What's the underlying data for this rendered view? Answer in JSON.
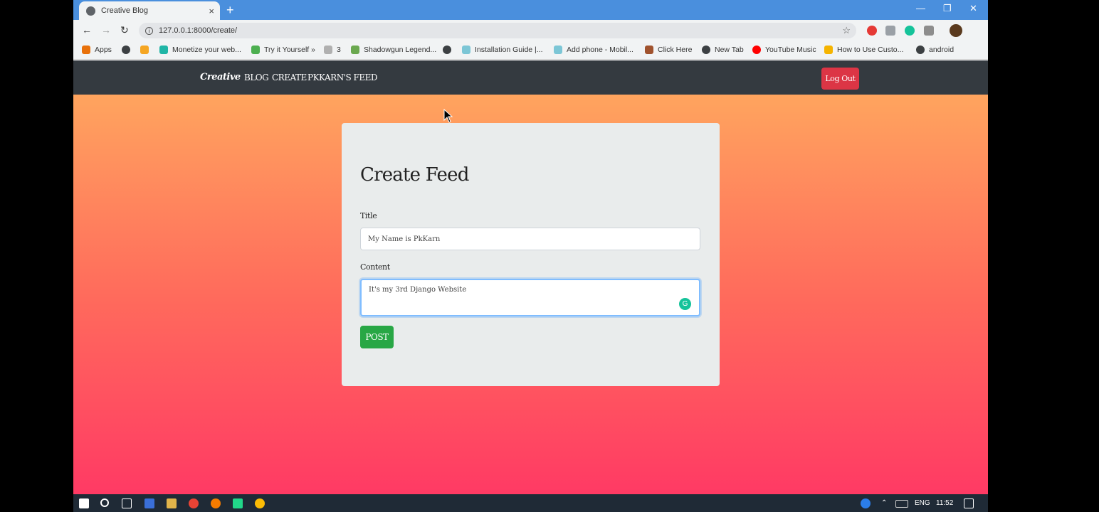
{
  "browser": {
    "tab_title": "Creative Blog",
    "tab_close": "×",
    "new_tab": "+",
    "url": "127.0.0.1:8000/create/",
    "window_controls": [
      "—",
      "❐",
      "✕"
    ]
  },
  "bookmarks": [
    {
      "label": "Apps",
      "icon": "apps-grid-icon"
    },
    {
      "label": "",
      "icon": "globe-icon"
    },
    {
      "label": "",
      "icon": "cp-icon"
    },
    {
      "label": "Monetize your web...",
      "icon": "monetize-icon"
    },
    {
      "label": "Try it Yourself »",
      "icon": "w3-icon"
    },
    {
      "label": "3",
      "icon": "k-icon"
    },
    {
      "label": "Shadowgun Legend...",
      "icon": "android-icon"
    },
    {
      "label": "",
      "icon": "globe-icon"
    },
    {
      "label": "Installation Guide |...",
      "icon": "link-icon"
    },
    {
      "label": "Add phone - Mobil...",
      "icon": "link-icon"
    },
    {
      "label": "Click Here",
      "icon": "hat-icon"
    },
    {
      "label": "New Tab",
      "icon": "globe-icon"
    },
    {
      "label": "YouTube Music",
      "icon": "youtube-music-icon"
    },
    {
      "label": "How to Use Custo...",
      "icon": "bolt-icon"
    },
    {
      "label": "android",
      "icon": "globe-icon"
    }
  ],
  "nav": {
    "brand": "Creative",
    "links": [
      "BLOG",
      "CREATE",
      "PKKARN'S FEED"
    ],
    "logout": "Log Out"
  },
  "form": {
    "heading": "Create Feed",
    "title_label": "Title",
    "title_value": "My Name is PkKarn",
    "content_label": "Content",
    "content_value": "It's my 3rd Django Website",
    "submit": "POST"
  },
  "taskbar": {
    "language": "ENG",
    "time": "11:52"
  },
  "colors": {
    "navbar": "#343a40",
    "logout": "#dc3545",
    "post": "#28a745",
    "gradient_top": "#ffae5f",
    "gradient_bottom": "#ff3a64"
  }
}
